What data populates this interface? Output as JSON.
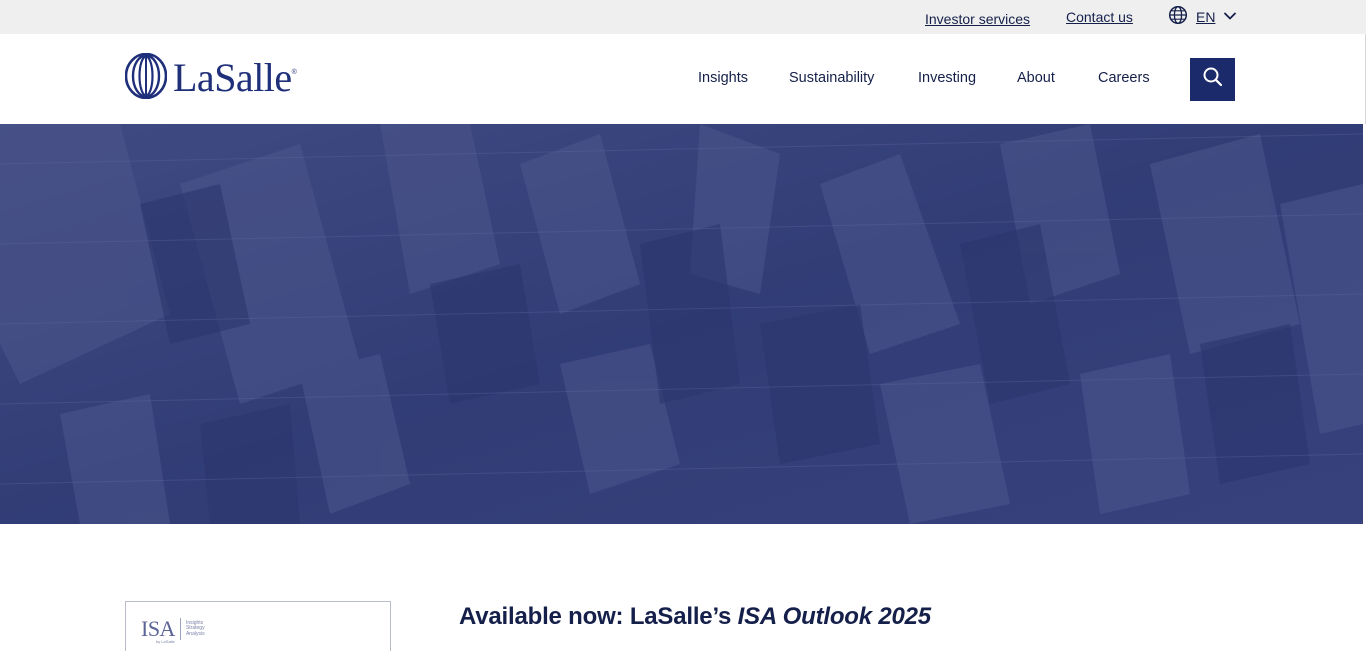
{
  "utility_bar": {
    "investor_services": "Investor services",
    "contact_us": "Contact us",
    "language": "EN",
    "globe_icon": "globe-icon",
    "chevron_icon": "chevron-down-icon"
  },
  "header": {
    "logo_text": "LaSalle",
    "logo_mark": "®",
    "nav": [
      "Insights",
      "Sustainability",
      "Investing",
      "About",
      "Careers"
    ],
    "search_icon": "search-icon"
  },
  "hero": {
    "image": "aerial-city-photo",
    "overlay_color": "#2e3a78"
  },
  "feature": {
    "thumbnail": {
      "title": "ISA",
      "subtitle_lines": [
        "Insights",
        "Strategy",
        "Analysis"
      ],
      "by_line": "by LaSalle"
    },
    "headline_prefix": "Available now: LaSalle’s ",
    "headline_emphasis": "ISA Outlook 2025"
  },
  "colors": {
    "brand_navy": "#15204a",
    "logo_blue": "#1f2f7a",
    "search_button": "#1b2a6b",
    "utility_bg": "#efefef"
  }
}
